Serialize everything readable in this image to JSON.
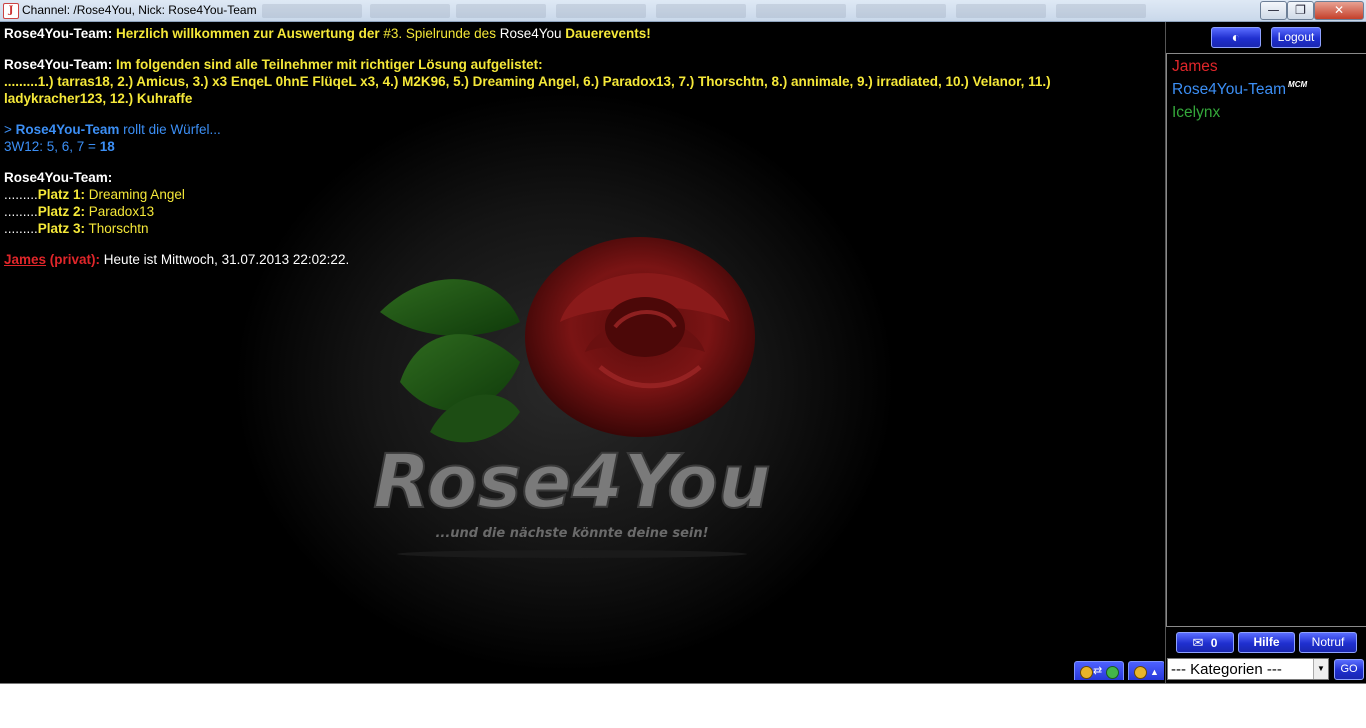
{
  "window": {
    "title": "Channel: /Rose4You,  Nick: Rose4You-Team",
    "buttons": {
      "minimize": "—",
      "maximize": "❐",
      "close": "✕"
    }
  },
  "background": {
    "logo_main": "Rose4You",
    "logo_tagline": "...und die nächste könnte deine sein!"
  },
  "messages": [
    {
      "sender": "Rose4You-Team:",
      "parts": [
        "Herzlich willkommen zur Auswertung der ",
        "#3. Spielrunde des ",
        "Rose4You",
        " Dauerevents!"
      ]
    },
    {
      "sender": "Rose4You-Team:",
      "line1": "Im folgenden sind alle Teilnehmer mit richtiger Lösung aufgelistet:",
      "line2": ".........1.) tarras18, 2.) Amicus, 3.) x3 EnqeL 0hnE FlüqeL x3, 4.) M2K96, 5.) Dreaming Angel, 6.) Paradox13, 7.) Thorschtn, 8.) annimale, 9.) irradiated, 10.) Velanor, 11.)",
      "line3": "ladykracher123, 12.) Kuhraffe"
    },
    {
      "prefix": "> ",
      "actor": "Rose4You-Team",
      "action": " rollt die Würfel...",
      "roll": "3W12: 5, 6, 7 = ",
      "total": "18"
    },
    {
      "sender": "Rose4You-Team:",
      "places": [
        {
          "dots": ".........",
          "label": "Platz 1:",
          "name": " Dreaming Angel"
        },
        {
          "dots": ".........",
          "label": "Platz 2:",
          "name": " Paradox13"
        },
        {
          "dots": ".........",
          "label": "Platz 3:",
          "name": " Thorschtn"
        }
      ]
    },
    {
      "sender": "James",
      "tag": " (privat):",
      "text": " Heute ist Mittwoch, 31.07.2013 22:02:22."
    }
  ],
  "sidebar": {
    "logout_label": "Logout",
    "users": [
      {
        "name": "James",
        "color": "#e0262a"
      },
      {
        "name": "Rose4You-Team",
        "color": "#3c8ff5",
        "badge": "MCM"
      },
      {
        "name": "Icelynx",
        "color": "#34a83a"
      }
    ],
    "mail_count": "0",
    "help_label": "Hilfe",
    "emergency_label": "Notruf"
  },
  "bottom": {
    "category_select": "--- Kategorien ---",
    "go_label": "GO"
  },
  "colors": {
    "accent_blue_button": "#2333d6",
    "yellow_text": "#f5e839",
    "nick_blue": "#3c8ff5",
    "private_red": "#e0262a"
  }
}
